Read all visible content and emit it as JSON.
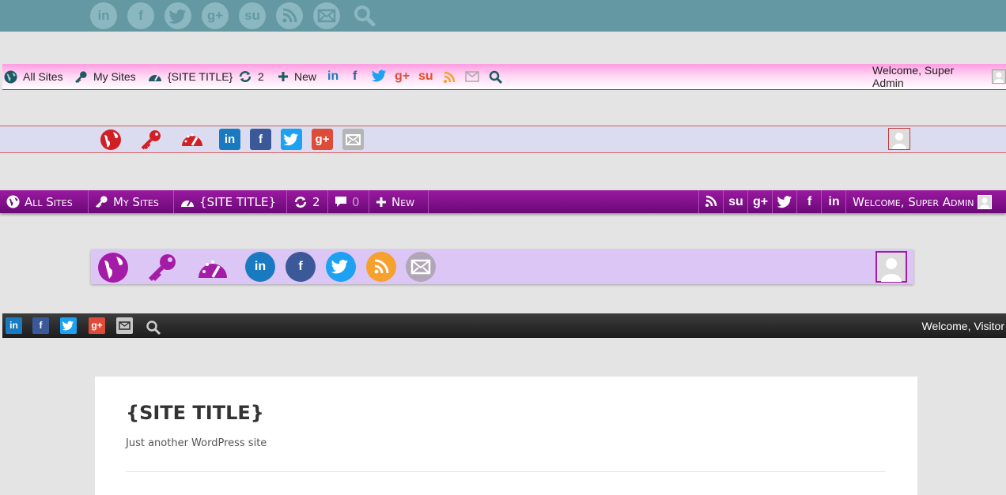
{
  "bar1": {
    "icons": [
      "linkedin-icon",
      "facebook-icon",
      "twitter-icon",
      "googleplus-icon",
      "stumbleupon-icon",
      "rss-icon",
      "mail-icon",
      "search-icon"
    ],
    "glyphs": {
      "linkedin": "in",
      "facebook": "f",
      "googleplus": "g+",
      "stumbleupon": "su",
      "rss": "))"
    }
  },
  "bar2": {
    "all_sites": "All Sites",
    "my_sites": "My Sites",
    "site_title": "{SITE TITLE}",
    "updates": "2",
    "new": "New",
    "welcome": "Welcome, Super Admin",
    "glyphs": {
      "linkedin": "in",
      "facebook": "f",
      "googleplus": "g+",
      "stumbleupon": "su"
    }
  },
  "bar3": {
    "glyphs": {
      "linkedin": "in",
      "facebook": "f",
      "googleplus": "g+"
    }
  },
  "bar4": {
    "all_sites": "All Sites",
    "my_sites": "My Sites",
    "site_title": "{SITE TITLE}",
    "updates": "2",
    "comments": "0",
    "new": "New",
    "welcome": "Welcome, Super Admin",
    "glyphs": {
      "stumbleupon": "su",
      "googleplus": "g+",
      "facebook": "f",
      "linkedin": "in"
    }
  },
  "bar5": {
    "glyphs": {
      "linkedin": "in",
      "facebook": "f"
    }
  },
  "bar6": {
    "welcome": "Welcome, Visitor",
    "glyphs": {
      "linkedin": "in",
      "facebook": "f",
      "googleplus": "g+"
    }
  },
  "site": {
    "title": "{SITE TITLE}",
    "tagline": "Just another WordPress site"
  },
  "colors": {
    "teal": "#6499a3",
    "pink": "#ff9be0",
    "purple": "#7d0c88",
    "lavender": "#dcc6f5",
    "dark": "#2a2a2a"
  }
}
